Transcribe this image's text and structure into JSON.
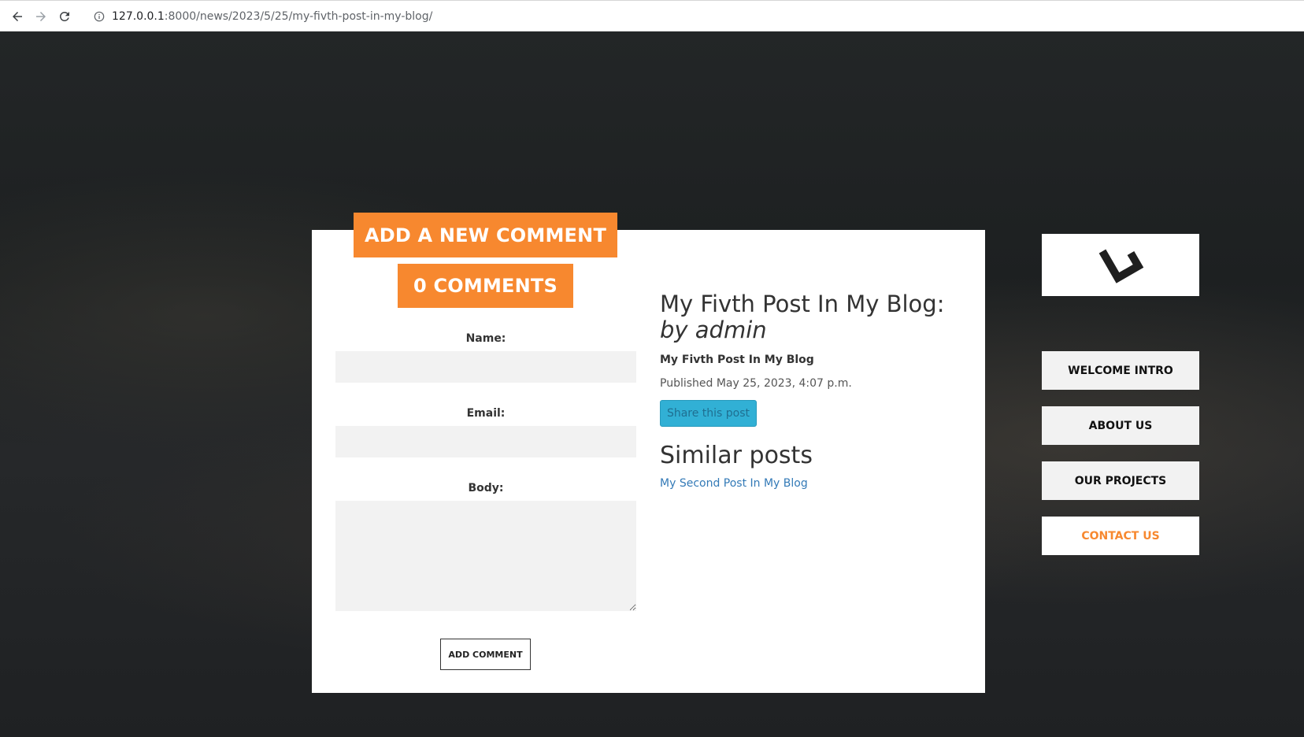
{
  "browser": {
    "url_host": "127.0.0.1",
    "url_rest": ":8000/news/2023/5/25/my-fivth-post-in-my-blog/"
  },
  "comments": {
    "add_heading": "ADD A NEW COMMENT",
    "count_label": "0 COMMENTS",
    "name_label": "Name:",
    "email_label": "Email:",
    "body_label": "Body:",
    "name_value": "",
    "email_value": "",
    "body_value": "",
    "submit_label": "ADD COMMENT"
  },
  "post": {
    "title": "My Fivth Post In My Blog:",
    "byline": "by admin",
    "subtitle": "My Fivth Post In My Blog",
    "published": "Published May 25, 2023, 4:07 p.m.",
    "share_label": "Share this post",
    "similar_heading": "Similar posts",
    "similar_posts": [
      "My Second Post In My Blog"
    ]
  },
  "sidebar": {
    "logo_icon": "brand-logo-icon",
    "items": [
      {
        "label": "WELCOME INTRO"
      },
      {
        "label": "ABOUT US"
      },
      {
        "label": "OUR PROJECTS"
      },
      {
        "label": "CONTACT US",
        "active": true
      }
    ]
  },
  "colors": {
    "accent": "#f7882f",
    "link": "#337ab7",
    "share_button": "#31b0d5"
  }
}
